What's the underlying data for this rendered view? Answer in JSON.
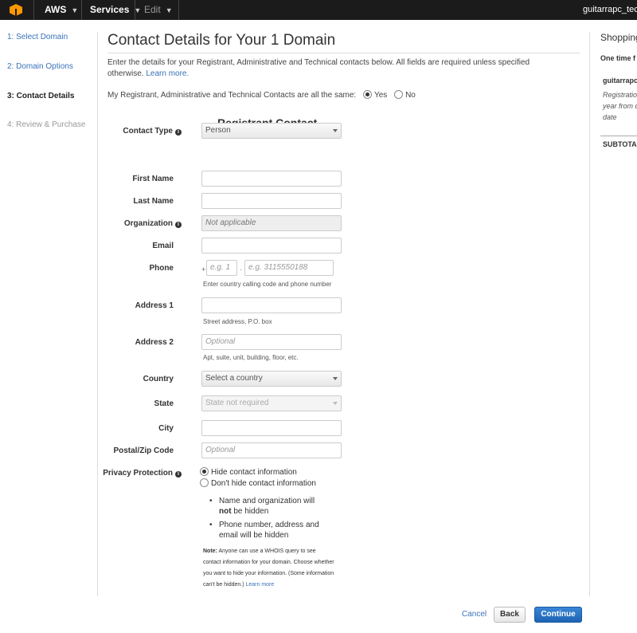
{
  "topbar": {
    "brand": "AWS",
    "services": "Services",
    "edit": "Edit",
    "user": "guitarrapc_tec"
  },
  "steps": [
    {
      "label": "1: Select Domain",
      "state": "link"
    },
    {
      "label": "2: Domain Options",
      "state": "link"
    },
    {
      "label": "3: Contact Details",
      "state": "active"
    },
    {
      "label": "4: Review & Purchase",
      "state": "disabled"
    }
  ],
  "page": {
    "title": "Contact Details for Your 1 Domain",
    "intro": "Enter the details for your Registrant, Administrative and Technical contacts below. All fields are required unless specified otherwise.",
    "learn_more": "Learn more.",
    "same_question": "My Registrant, Administrative and Technical Contacts are all the same:",
    "yes": "Yes",
    "no": "No"
  },
  "form": {
    "section_title": "Registrant Contact",
    "contact_type_label": "Contact Type",
    "contact_type_value": "Person",
    "first_name_label": "First Name",
    "last_name_label": "Last Name",
    "organization_label": "Organization",
    "organization_value": "Not applicable",
    "email_label": "Email",
    "phone_label": "Phone",
    "phone_plus": "+",
    "phone_country_placeholder": "e.g. 1",
    "phone_dash": "-",
    "phone_number_placeholder": "e.g. 3115550188",
    "phone_help": "Enter country calling code and phone number",
    "address1_label": "Address 1",
    "address1_help": "Street address, P.O. box",
    "address2_label": "Address 2",
    "address2_placeholder": "Optional",
    "address2_help": "Apt, suite, unit, building, floor, etc.",
    "country_label": "Country",
    "country_value": "Select a country",
    "state_label": "State",
    "state_value": "State not required",
    "city_label": "City",
    "postal_label": "Postal/Zip Code",
    "postal_placeholder": "Optional",
    "privacy_label": "Privacy Protection",
    "privacy_hide": "Hide contact information",
    "privacy_show": "Don't hide contact information",
    "bullet1_a": "Name and organization will ",
    "bullet1_b": "not",
    "bullet1_c": " be hidden",
    "bullet2": "Phone number, address and email will be hidden",
    "note_label": "Note:",
    "note_text": " Anyone can use a WHOIS query to see contact information for your domain. Choose whether you want to hide your information. (Some information can't be hidden.) ",
    "note_link": "Learn more"
  },
  "cart": {
    "title": "Shopping",
    "one_time": "One time f",
    "domain": "guitarrapc",
    "desc1": "Registratio",
    "desc2": "year from d",
    "desc3": "date",
    "subtotal": "SUBTOTA"
  },
  "actions": {
    "cancel": "Cancel",
    "back": "Back",
    "continue": "Continue"
  }
}
